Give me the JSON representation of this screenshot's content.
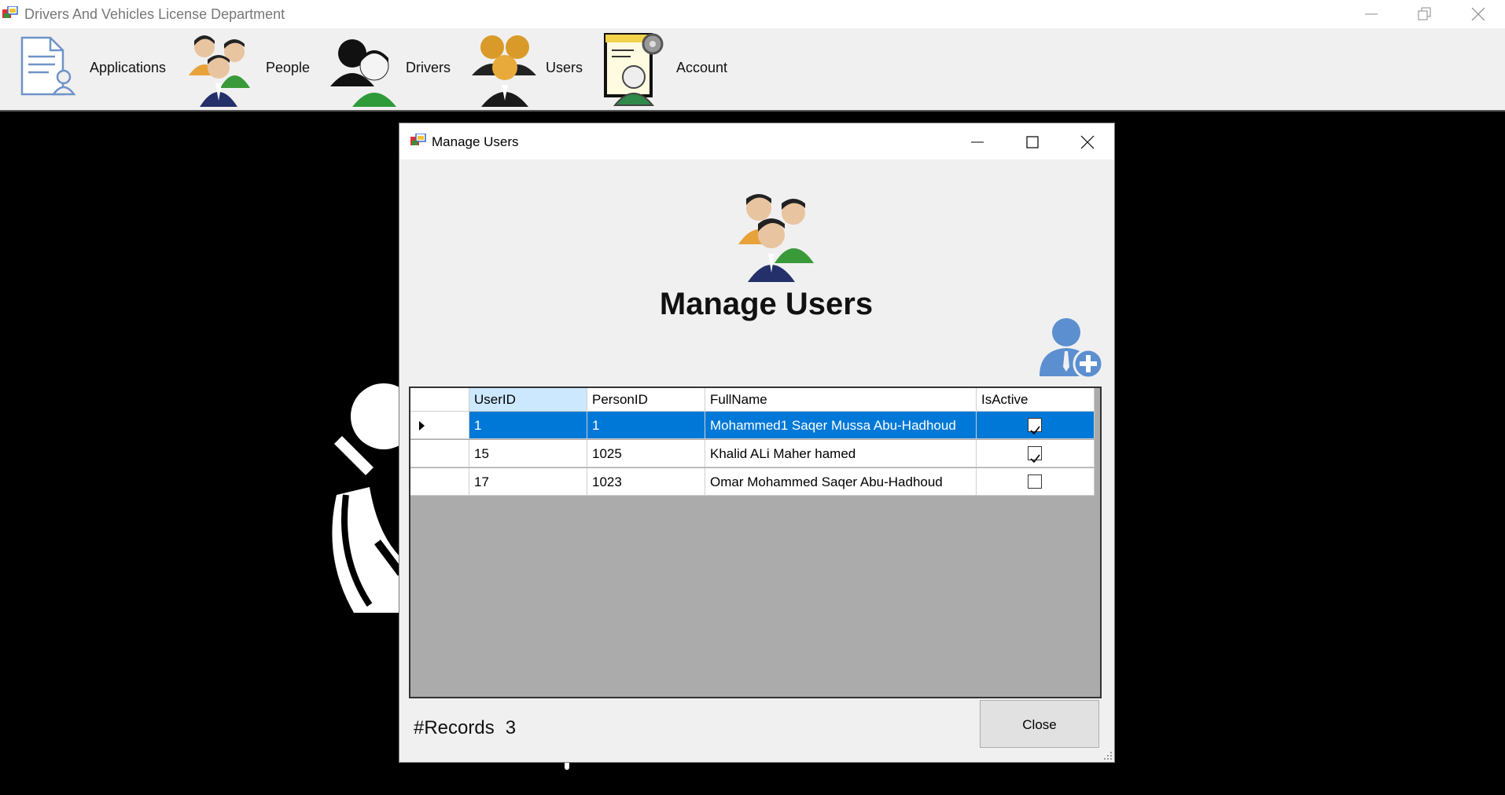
{
  "window": {
    "title": "Drivers And Vehicles License Department"
  },
  "menu": {
    "items": [
      {
        "label": "Applications",
        "icon": "applications-icon"
      },
      {
        "label": "People",
        "icon": "people-icon"
      },
      {
        "label": "Drivers",
        "icon": "drivers-icon"
      },
      {
        "label": "Users",
        "icon": "users-icon"
      },
      {
        "label": "Account",
        "icon": "account-icon"
      }
    ]
  },
  "dialog": {
    "title": "Manage Users",
    "header_title": "Manage Users",
    "grid": {
      "columns": [
        "UserID",
        "PersonID",
        "FullName",
        "IsActive"
      ],
      "rows": [
        {
          "UserID": "1",
          "PersonID": "1",
          "FullName": "Mohammed1 Saqer Mussa Abu-Hadhoud",
          "IsActive": true,
          "selected": true
        },
        {
          "UserID": "15",
          "PersonID": "1025",
          "FullName": "Khalid ALi Maher hamed",
          "IsActive": true,
          "selected": false
        },
        {
          "UserID": "17",
          "PersonID": "1023",
          "FullName": "Omar Mohammed Saqer Abu-Hadhoud",
          "IsActive": false,
          "selected": false
        }
      ]
    },
    "records_label": "#Records",
    "records_count": "3",
    "close_label": "Close"
  },
  "colors": {
    "selection": "#0078d7",
    "sorted_header": "#cce8ff",
    "grid_background": "#ababab"
  }
}
